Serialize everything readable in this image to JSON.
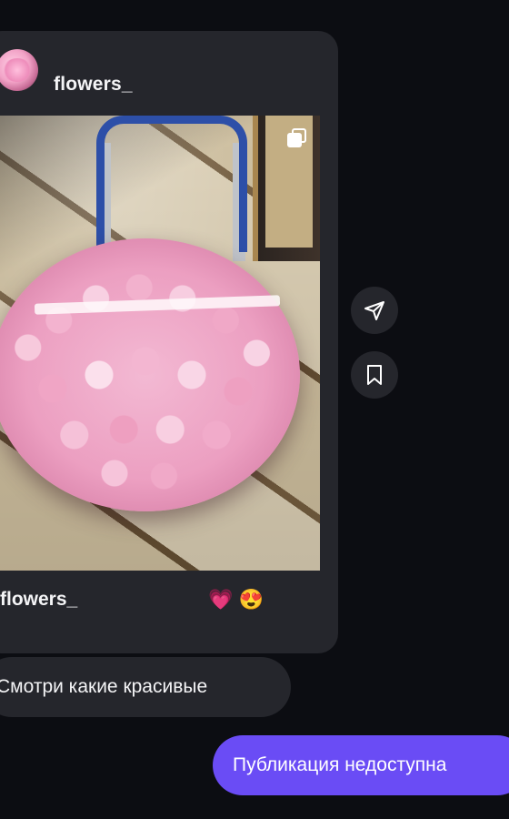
{
  "post": {
    "username": "flowers_",
    "caption_user": "flowers_",
    "caption_emojis": "💗 😍",
    "multi_icon": "carousel-icon"
  },
  "actions": {
    "share_icon": "send-icon",
    "save_icon": "bookmark-icon"
  },
  "messages": {
    "incoming": "Смотри какие красивые",
    "outgoing": "Публикация недоступна"
  },
  "colors": {
    "background": "#0c0d12",
    "bubble_incoming": "#25262c",
    "bubble_outgoing": "#6a4cf5"
  }
}
